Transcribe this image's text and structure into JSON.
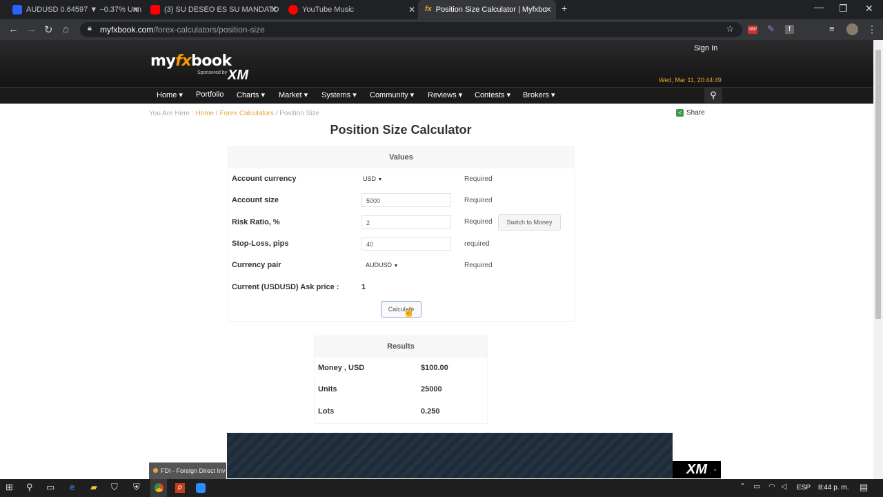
{
  "browser": {
    "tabs": [
      {
        "label": "AUDUSD 0.64597 ▼ −0.37% Unn",
        "favicon_color": "#2962ff"
      },
      {
        "label": "(3) SU DESEO ES SU MANDATO",
        "favicon_color": "#ff0000"
      },
      {
        "label": "YouTube Music",
        "favicon_color": "#ff0000"
      },
      {
        "label": "Position Size Calculator | Myfxbo",
        "favicon_color": "#f5a623",
        "favicon_text": "fx"
      }
    ],
    "url_host": "myfxbook.com",
    "url_path": "/forex-calculators/position-size",
    "ext_badge": "ABP",
    "ext_badge_count": "4"
  },
  "site": {
    "logo_main": "my",
    "logo_fx": "fx",
    "logo_book": "book",
    "sponsored": "Sponsored by",
    "xm": "XM",
    "signin": "Sign In",
    "datetime": "Wed, Mar 11, 20:44:49",
    "nav": [
      "Home ▾",
      "Portfolio",
      "Charts ▾",
      "Market ▾",
      "Systems ▾",
      "Community ▾",
      "Reviews ▾",
      "Contests ▾",
      "Brokers ▾"
    ]
  },
  "breadcrumb": {
    "prefix": "You Are Here : ",
    "home": "Home",
    "sep1": " / ",
    "section": "Forex Calculators",
    "sep2": " / ",
    "current": "Position Size"
  },
  "share": "Share",
  "title": "Position Size Calculator",
  "values": {
    "heading": "Values",
    "account_currency": {
      "label": "Account currency",
      "value": "USD",
      "req": "Required"
    },
    "account_size": {
      "label": "Account size",
      "value": "5000",
      "req": "Required"
    },
    "risk_ratio": {
      "label": "Risk Ratio, %",
      "value": "2",
      "req": "Required",
      "switch": "Switch to Money"
    },
    "stop_loss": {
      "label": "Stop-Loss, pips",
      "value": "40",
      "req": "required"
    },
    "currency_pair": {
      "label": "Currency pair",
      "value": "AUDUSD",
      "req": "Required"
    },
    "ask_price": {
      "label": "Current (USDUSD) Ask price :",
      "value": "1"
    },
    "calculate": "Calculate"
  },
  "results": {
    "heading": "Results",
    "rows": [
      {
        "label": "Money , USD",
        "value": "$100.00"
      },
      {
        "label": "Units",
        "value": "25000"
      },
      {
        "label": "Lots",
        "value": "0.250"
      }
    ]
  },
  "ad_logo": "XM",
  "download": "FDI - Foreign Direct Inv",
  "taskbar": {
    "lang": "ESP",
    "time": "8:44 p. m."
  }
}
